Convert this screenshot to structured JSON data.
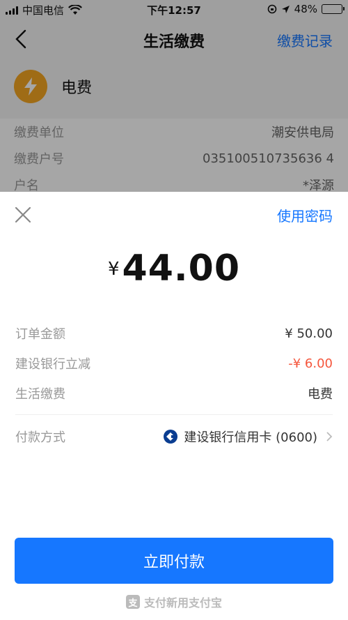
{
  "status_bar": {
    "carrier": "中国电信",
    "time": "下午12:57",
    "battery": "48%"
  },
  "nav": {
    "title": "生活缴费",
    "right_link": "缴费记录"
  },
  "biller": {
    "name": "电费"
  },
  "background_rows": [
    {
      "label": "缴费单位",
      "value": "潮安供电局"
    },
    {
      "label": "缴费户号",
      "value": "035100510735636 4"
    },
    {
      "label": "户名",
      "value": "*泽源"
    }
  ],
  "sheet": {
    "password_link": "使用密码",
    "currency_symbol": "¥",
    "amount": "44.00",
    "details": [
      {
        "label": "订单金额",
        "value": "¥ 50.00"
      },
      {
        "label": "建设银行立减",
        "value": "-¥ 6.00"
      },
      {
        "label": "生活缴费",
        "value": "电费"
      }
    ],
    "pay_method": {
      "label": "付款方式",
      "value": "建设银行信用卡 (0600)"
    },
    "pay_button": "立即付款",
    "footer": "支付新用支付宝"
  },
  "colors": {
    "accent": "#1677ff",
    "discount": "#f5563c",
    "biller_logo": "#f5a623"
  }
}
